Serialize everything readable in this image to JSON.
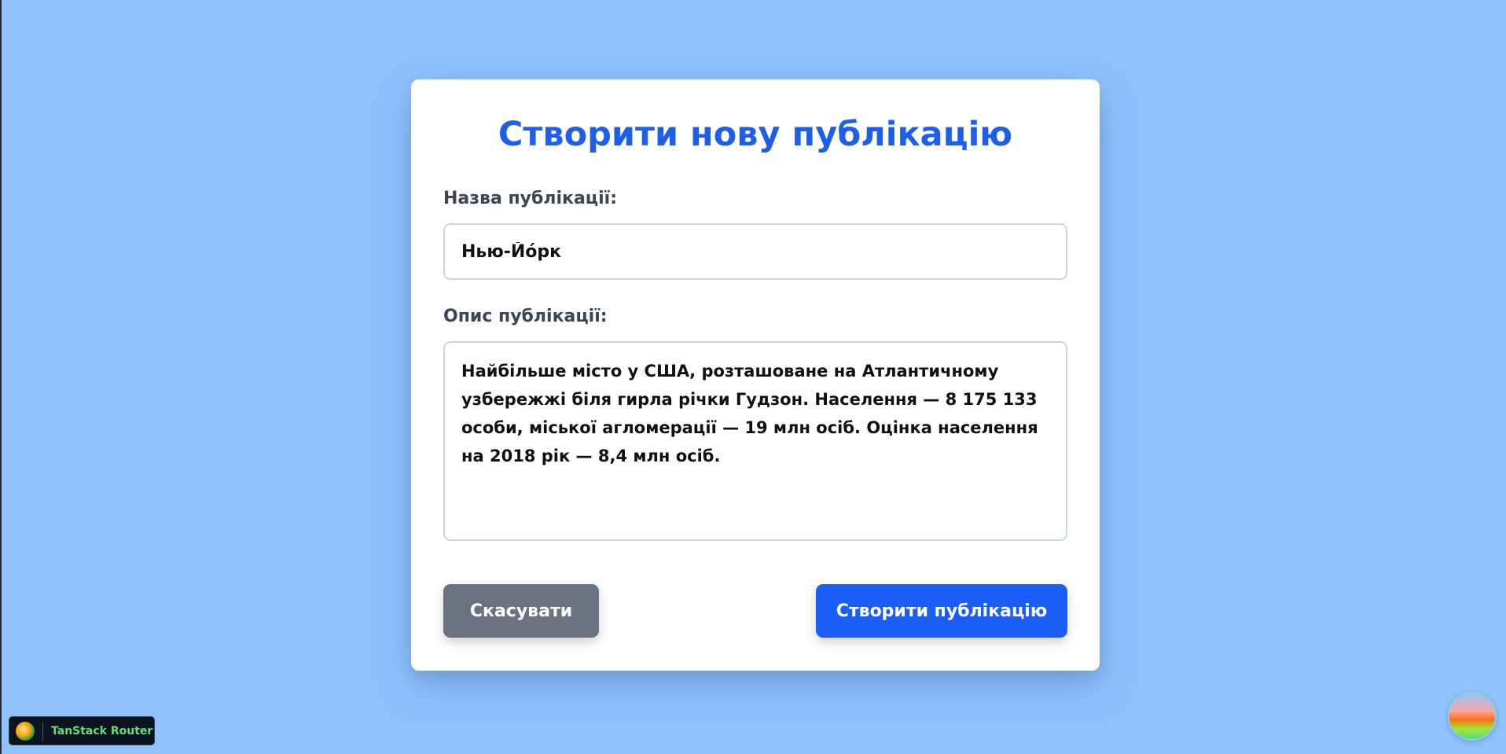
{
  "page": {
    "background_color": "#90c3fc"
  },
  "form": {
    "title": "Створити нову публікацію",
    "title_color": "#1d5fe8",
    "name_label": "Назва публікації:",
    "name_value": "Нью-Йо́рк",
    "description_label": "Опис публікації:",
    "description_value": "Найбільше місто у США, розташоване на Атлантичному узбережжі біля гирла річки Гудзон. Населення — 8 175 133 особи, міської агломерації — 19 млн осіб. Оцінка населення на 2018 рік — 8,4 млн осіб.",
    "cancel_label": "Скасувати",
    "submit_label": "Створити публікацію",
    "cancel_color": "#6b7280",
    "submit_color": "#1a5ef5"
  },
  "devtools": {
    "label": "TanStack Router",
    "icon": "tanstack-logo-icon"
  },
  "floating_badge": {
    "icon": "query-devtools-icon"
  }
}
